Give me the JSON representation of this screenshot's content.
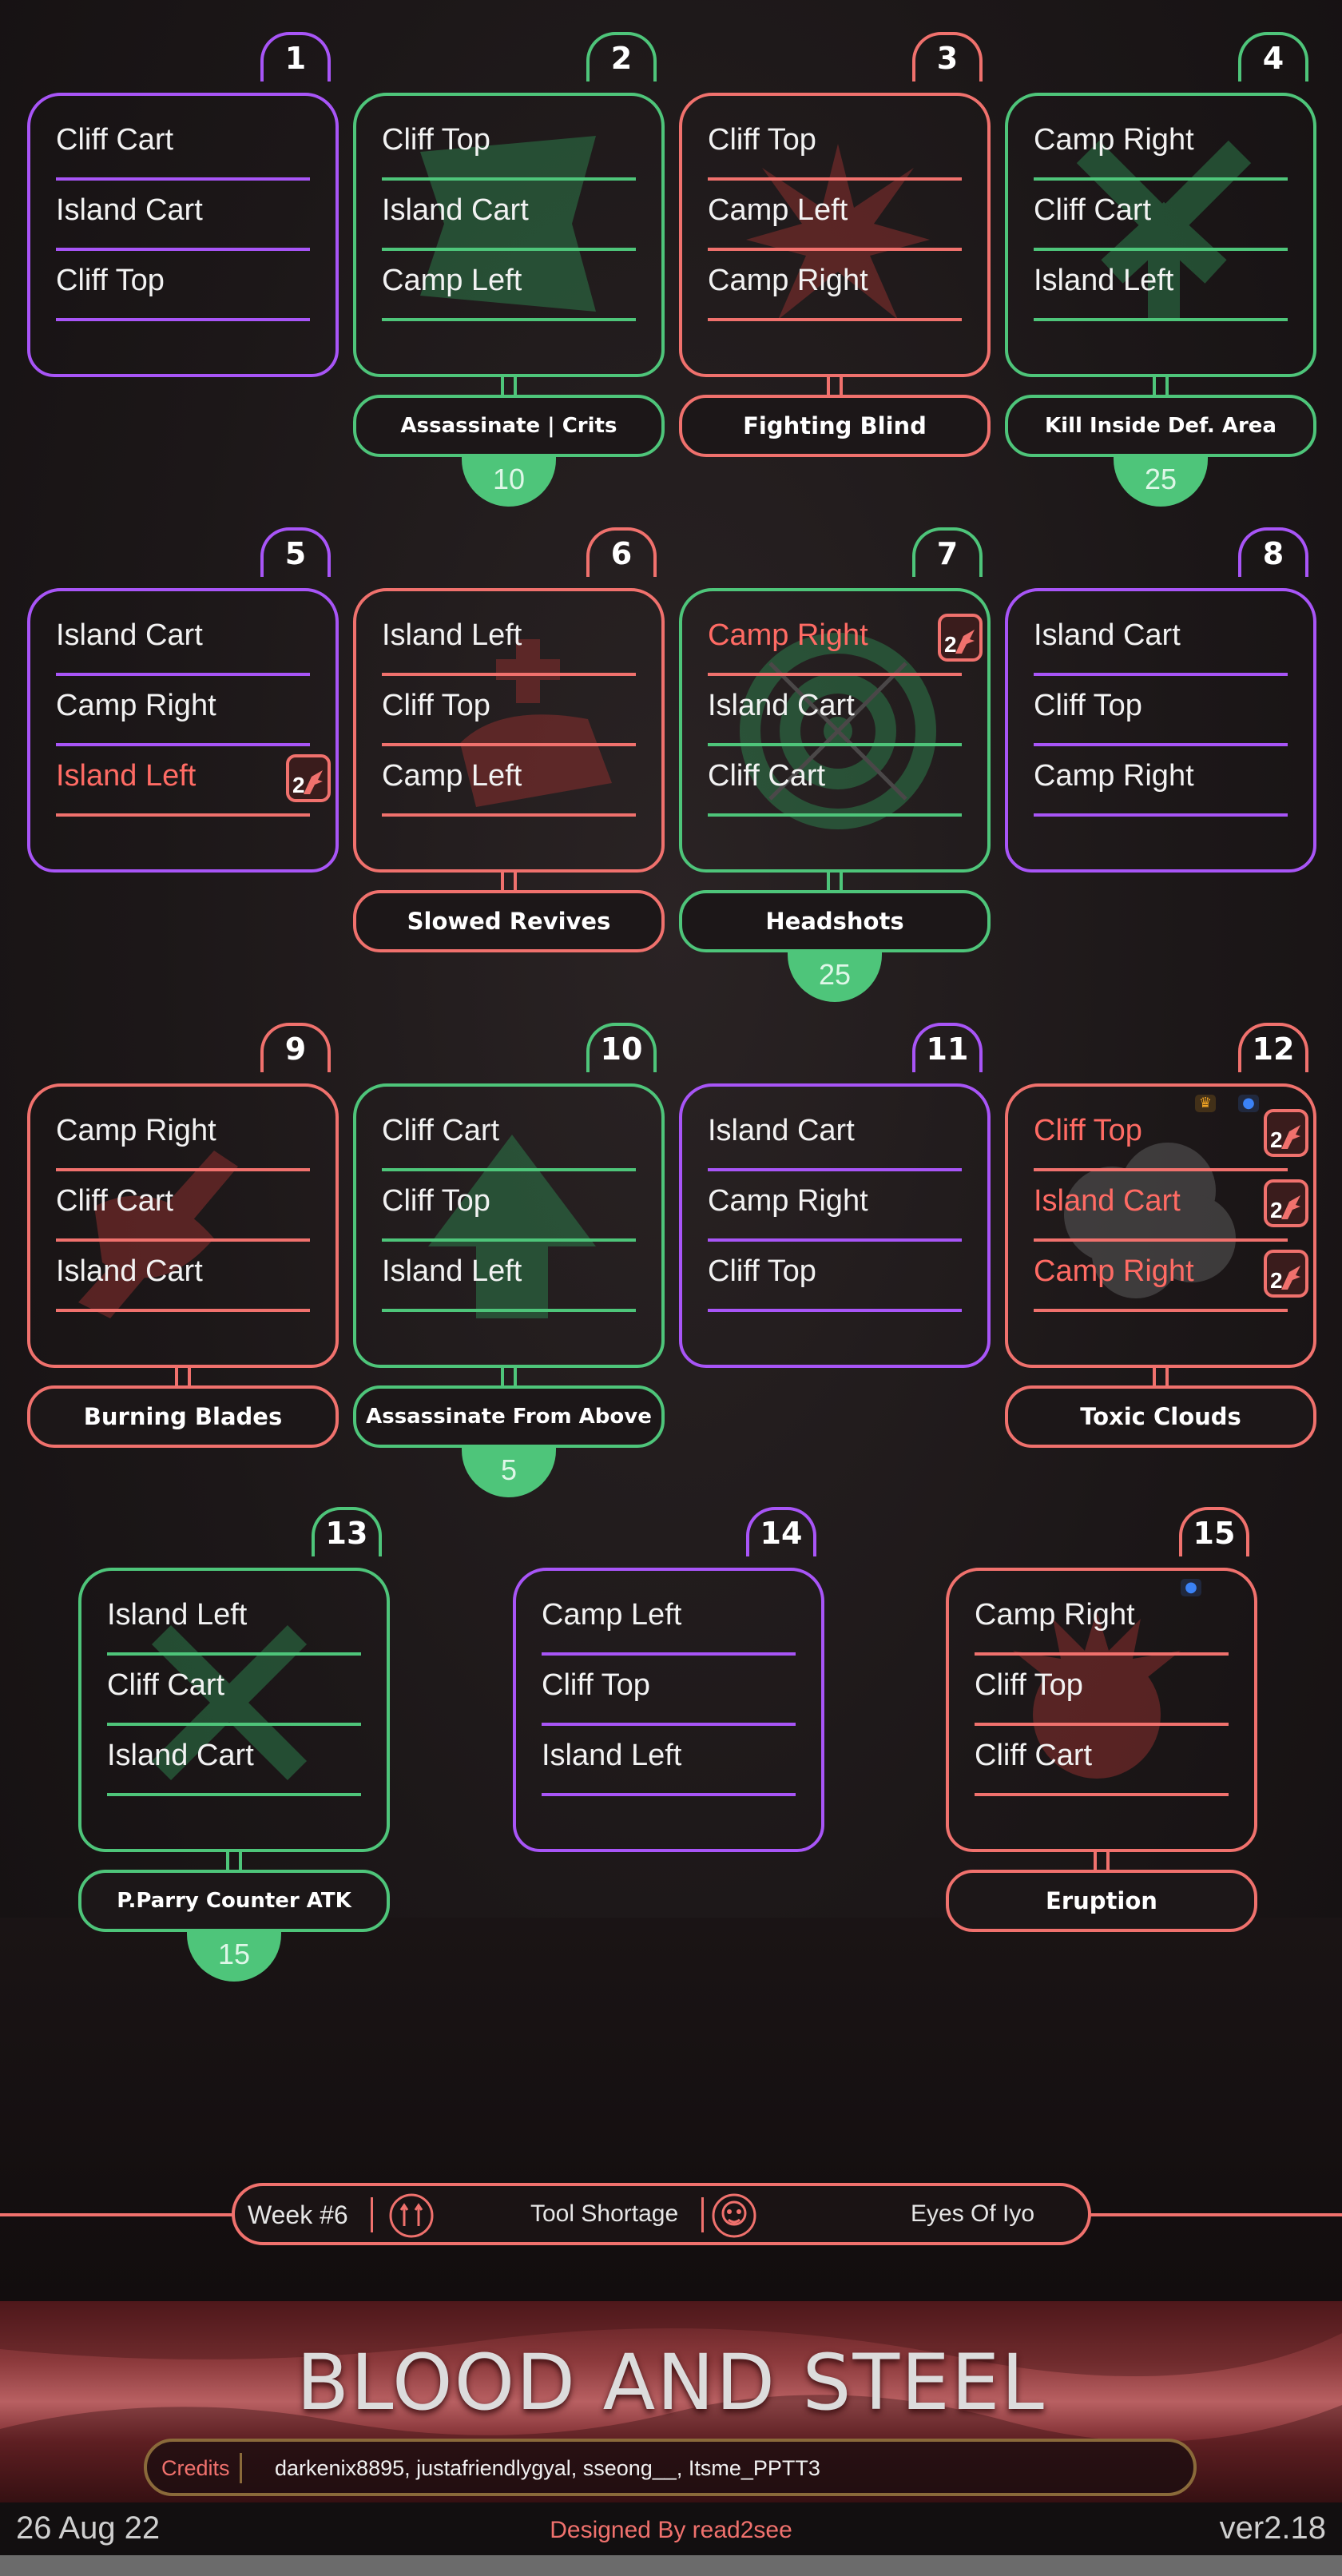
{
  "cards": [
    {
      "num": "1",
      "color": "purple",
      "items": [
        {
          "label": "Cliff Cart",
          "hl": false,
          "badge": ""
        },
        {
          "label": "Island Cart",
          "hl": false,
          "badge": ""
        },
        {
          "label": "Cliff Top",
          "hl": false,
          "badge": ""
        }
      ],
      "modifier": "",
      "score": ""
    },
    {
      "num": "2",
      "color": "green",
      "items": [
        {
          "label": "Cliff Top",
          "hl": false,
          "badge": ""
        },
        {
          "label": "Island Cart",
          "hl": false,
          "badge": ""
        },
        {
          "label": "Camp Left",
          "hl": false,
          "badge": ""
        }
      ],
      "modifier": "Assassinate | Crits",
      "score": "10"
    },
    {
      "num": "3",
      "color": "red",
      "items": [
        {
          "label": "Cliff Top",
          "hl": false,
          "badge": ""
        },
        {
          "label": "Camp Left",
          "hl": false,
          "badge": ""
        },
        {
          "label": "Camp Right",
          "hl": false,
          "badge": ""
        }
      ],
      "modifier": "Fighting Blind",
      "score": ""
    },
    {
      "num": "4",
      "color": "green",
      "items": [
        {
          "label": "Camp Right",
          "hl": false,
          "badge": ""
        },
        {
          "label": "Cliff Cart",
          "hl": false,
          "badge": ""
        },
        {
          "label": "Island Left",
          "hl": false,
          "badge": ""
        }
      ],
      "modifier": "Kill Inside Def. Area",
      "score": "25"
    },
    {
      "num": "5",
      "color": "purple",
      "items": [
        {
          "label": "Island Cart",
          "hl": false,
          "badge": ""
        },
        {
          "label": "Camp Right",
          "hl": false,
          "badge": ""
        },
        {
          "label": "Island Left",
          "hl": true,
          "badge": "2"
        }
      ],
      "modifier": "",
      "score": ""
    },
    {
      "num": "6",
      "color": "red",
      "items": [
        {
          "label": "Island Left",
          "hl": false,
          "badge": ""
        },
        {
          "label": "Cliff Top",
          "hl": false,
          "badge": ""
        },
        {
          "label": "Camp Left",
          "hl": false,
          "badge": ""
        }
      ],
      "modifier": "Slowed Revives",
      "score": ""
    },
    {
      "num": "7",
      "color": "green",
      "items": [
        {
          "label": "Camp Right",
          "hl": true,
          "badge": "2"
        },
        {
          "label": "Island Cart",
          "hl": false,
          "badge": ""
        },
        {
          "label": "Cliff Cart",
          "hl": false,
          "badge": ""
        }
      ],
      "modifier": "Headshots",
      "score": "25"
    },
    {
      "num": "8",
      "color": "purple",
      "items": [
        {
          "label": "Island Cart",
          "hl": false,
          "badge": ""
        },
        {
          "label": "Cliff Top",
          "hl": false,
          "badge": ""
        },
        {
          "label": "Camp Right",
          "hl": false,
          "badge": ""
        }
      ],
      "modifier": "",
      "score": ""
    },
    {
      "num": "9",
      "color": "red",
      "items": [
        {
          "label": "Camp Right",
          "hl": false,
          "badge": ""
        },
        {
          "label": "Cliff Cart",
          "hl": false,
          "badge": ""
        },
        {
          "label": "Island Cart",
          "hl": false,
          "badge": ""
        }
      ],
      "modifier": "Burning Blades",
      "score": ""
    },
    {
      "num": "10",
      "color": "green",
      "items": [
        {
          "label": "Cliff Cart",
          "hl": false,
          "badge": ""
        },
        {
          "label": "Cliff Top",
          "hl": false,
          "badge": ""
        },
        {
          "label": "Island Left",
          "hl": false,
          "badge": ""
        }
      ],
      "modifier": "Assassinate From Above",
      "score": "5"
    },
    {
      "num": "11",
      "color": "purple",
      "items": [
        {
          "label": "Island Cart",
          "hl": false,
          "badge": ""
        },
        {
          "label": "Camp Right",
          "hl": false,
          "badge": ""
        },
        {
          "label": "Cliff Top",
          "hl": false,
          "badge": ""
        }
      ],
      "modifier": "",
      "score": ""
    },
    {
      "num": "12",
      "color": "red",
      "items": [
        {
          "label": "Cliff Top",
          "hl": true,
          "badge": "2"
        },
        {
          "label": "Island Cart",
          "hl": true,
          "badge": "2"
        },
        {
          "label": "Camp Right",
          "hl": true,
          "badge": "2"
        }
      ],
      "modifier": "Toxic Clouds",
      "score": ""
    },
    {
      "num": "13",
      "color": "green",
      "items": [
        {
          "label": "Island Left",
          "hl": false,
          "badge": ""
        },
        {
          "label": "Cliff Cart",
          "hl": false,
          "badge": ""
        },
        {
          "label": "Island Cart",
          "hl": false,
          "badge": ""
        }
      ],
      "modifier": "P.Parry Counter ATK",
      "score": "15"
    },
    {
      "num": "14",
      "color": "purple",
      "items": [
        {
          "label": "Camp Left",
          "hl": false,
          "badge": ""
        },
        {
          "label": "Cliff Top",
          "hl": false,
          "badge": ""
        },
        {
          "label": "Island Left",
          "hl": false,
          "badge": ""
        }
      ],
      "modifier": "",
      "score": ""
    },
    {
      "num": "15",
      "color": "red",
      "items": [
        {
          "label": "Camp Right",
          "hl": false,
          "badge": ""
        },
        {
          "label": "Cliff Top",
          "hl": false,
          "badge": ""
        },
        {
          "label": "Cliff Cart",
          "hl": false,
          "badge": ""
        }
      ],
      "modifier": "Eruption",
      "score": ""
    }
  ],
  "week": {
    "label": "Week #6",
    "modifier_1": "Tool Shortage",
    "modifier_2": "Eyes Of Iyo"
  },
  "banner": {
    "title": "BLOOD AND STEEL"
  },
  "credits": {
    "label": "Credits",
    "names": "darkenix8895, justafriendlygyal, sseong__, Itsme_PPTT3"
  },
  "footer": {
    "date": "26 Aug 22",
    "designer": "Designed By read2see",
    "version": "ver2.18"
  },
  "colors": {
    "purple": "#a855f7",
    "green": "#4ec57a",
    "red": "#f0716d"
  }
}
